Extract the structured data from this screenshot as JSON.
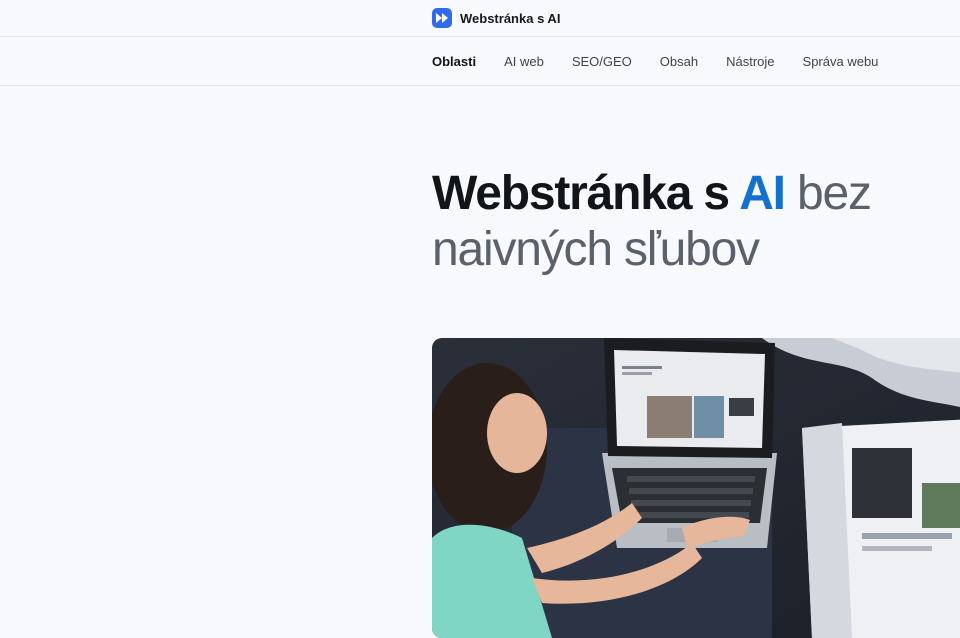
{
  "brand": {
    "name": "Webstránka s AI",
    "icon": "fast-forward-icon",
    "color": "#2f6bea"
  },
  "nav": {
    "items": [
      {
        "label": "Oblasti",
        "active": true
      },
      {
        "label": "AI web"
      },
      {
        "label": "SEO/GEO"
      },
      {
        "label": "Obsah"
      },
      {
        "label": "Nástroje"
      },
      {
        "label": "Správa webu"
      }
    ]
  },
  "hero": {
    "title_part1": "Webstránka s ",
    "title_accent": "AI",
    "title_part2": " bez naivných sľubov",
    "accent_color": "#1470d0"
  }
}
